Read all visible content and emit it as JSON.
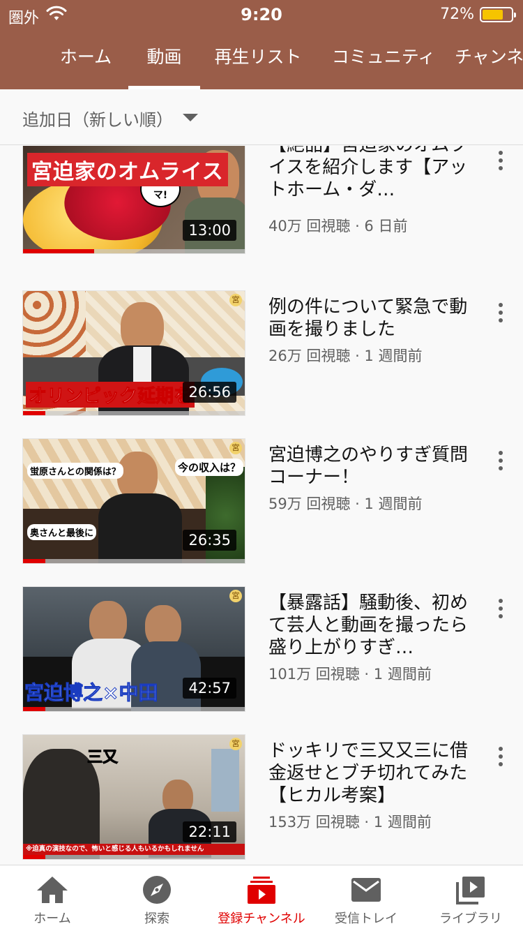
{
  "status": {
    "carrier": "圏外",
    "time": "9:20",
    "battery": "72%",
    "battery_level": 0.72
  },
  "tabs": [
    {
      "label": "ホーム"
    },
    {
      "label": "動画"
    },
    {
      "label": "再生リスト"
    },
    {
      "label": "コミュニティ"
    },
    {
      "label": "チャンネル"
    }
  ],
  "active_tab": "動画",
  "sort": {
    "label": "追加日（新しい順）"
  },
  "videos": [
    {
      "title": "【絶品】宮迫家のオムライスを紹介します【アットホーム・ダ…",
      "meta": "40万 回視聴 · 6 日前",
      "duration": "13:00",
      "progress": 0.32,
      "thumb_text": "宮迫家のオムライス",
      "thumb_sub": "マジウマ!"
    },
    {
      "title": "例の件について緊急で動画を撮りました",
      "meta": "26万 回視聴 · 1 週間前",
      "duration": "26:56",
      "progress": 0.1,
      "thumb_text": "オリンピック延期を"
    },
    {
      "title": "宮迫博之のやりすぎ質問コーナー！",
      "meta": "59万 回視聴 · 1 週間前",
      "duration": "26:35",
      "progress": 0.1,
      "thumb_text": "今の収入は？"
    },
    {
      "title": "【暴露話】騒動後、初めて芸人と動画を撮ったら盛り上がりすぎ…",
      "meta": "101万 回視聴 · 1 週間前",
      "duration": "42:57",
      "progress": 0.1,
      "thumb_text": "宮迫博之×中田"
    },
    {
      "title": "ドッキリで三又又三に借金返せとブチ切れてみた【ヒカル考案】",
      "meta": "153万 回視聴 · 1 週間前",
      "duration": "22:11",
      "progress": 0.1,
      "thumb_text": "三又",
      "thumb_sub": "※迫真の演技なので、怖いと感じる人もいるかもしれません"
    }
  ],
  "bottom_nav": [
    {
      "label": "ホーム",
      "icon": "home-icon"
    },
    {
      "label": "探索",
      "icon": "compass-icon"
    },
    {
      "label": "登録チャンネル",
      "icon": "subscriptions-icon"
    },
    {
      "label": "受信トレイ",
      "icon": "mail-icon"
    },
    {
      "label": "ライブラリ",
      "icon": "library-icon"
    }
  ],
  "colors": {
    "header": "#9a5d49",
    "accent": "#e00000",
    "text_secondary": "#606060"
  }
}
